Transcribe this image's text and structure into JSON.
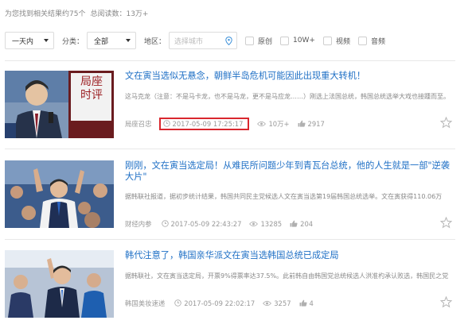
{
  "summary": {
    "results_text": "为您找到相关结果约75个",
    "reads_label": "总阅读数：",
    "reads_value": "13万+"
  },
  "filters": {
    "time_value": "一天内",
    "category_label": "分类：",
    "category_value": "全部",
    "region_label": "地区：",
    "city_placeholder": "选择城市",
    "checkboxes": [
      "原创",
      "10W+",
      "视频",
      "音频"
    ]
  },
  "articles": [
    {
      "title": "文在寅当选似无悬念，朝鲜半岛危机可能因此出现重大转机！",
      "snippet": "这马克龙（注意：不是马卡龙，也不是马龙，更不是马应龙……）刚选上法国总统，韩国总统选举大戏也接踵而至。",
      "source": "局座召忠",
      "time": "2017-05-09 17:25:17",
      "views": "10万+",
      "likes": "2917",
      "thumb_caption": "局座\n时评"
    },
    {
      "title": "刚刚，文在寅当选定局！从难民所问题少年到青瓦台总统，他的人生就是一部\"逆袭大片\"",
      "snippet": "据韩联社报道，据初步统计结果，韩国共同民主党候选人文在寅当选第19届韩国总统选举。文在寅获得110.06万",
      "source": "财经内参",
      "time": "2017-05-09 22:43:27",
      "views": "13285",
      "likes": "204"
    },
    {
      "title": "韩代注意了，韩国亲华派文在寅当选韩国总统已成定局",
      "snippet": "据韩联社，文在寅当选定局，开票9%得票率达37.5%。此前韩自由韩国党总统候选人洪准杓承认败选，韩国民之党",
      "source": "韩国美妆速递",
      "time": "2017-05-09 22:02:17",
      "views": "3257",
      "likes": "4"
    }
  ],
  "colors": {
    "title_link": "#1e6fc5",
    "highlight_border": "#d9272e",
    "meta_gray": "#999999"
  }
}
